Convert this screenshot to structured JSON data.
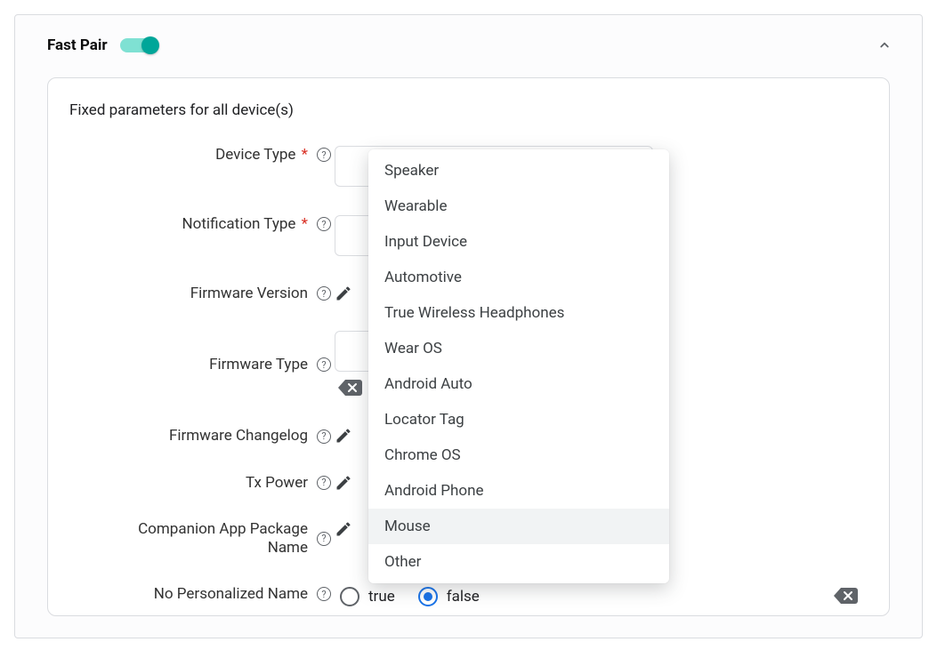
{
  "section": {
    "title": "Fast Pair",
    "toggle_on": true
  },
  "panel": {
    "title": "Fixed parameters for all device(s)"
  },
  "fields": {
    "device_type": {
      "label": "Device Type",
      "required": true
    },
    "notification_type": {
      "label": "Notification Type",
      "required": true
    },
    "firmware_version": {
      "label": "Firmware Version"
    },
    "firmware_type": {
      "label": "Firmware Type"
    },
    "firmware_changelog": {
      "label": "Firmware Changelog"
    },
    "tx_power": {
      "label": "Tx Power"
    },
    "companion_pkg": {
      "label": "Companion App Package Name"
    },
    "no_personalized_name": {
      "label": "No Personalized Name",
      "true_label": "true",
      "false_label": "false",
      "value": "false"
    }
  },
  "device_type_options": [
    "Speaker",
    "Wearable",
    "Input Device",
    "Automotive",
    "True Wireless Headphones",
    "Wear OS",
    "Android Auto",
    "Locator Tag",
    "Chrome OS",
    "Android Phone",
    "Mouse",
    "Other"
  ],
  "device_type_hovered": "Mouse"
}
